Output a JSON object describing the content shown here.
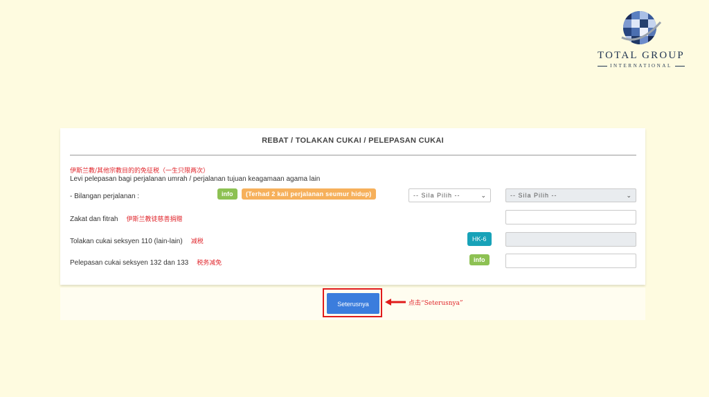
{
  "brand": {
    "name": "TOTAL GROUP",
    "tagline": "INTERNATIONAL"
  },
  "form": {
    "title": "REBAT / TOLAKAN CUKAI / PELEPASAN CUKAI",
    "levi_note_cn": "伊斯兰教/其他宗教目的的免征税（一生只限两次）",
    "levi_text": "Levi pelepasan bagi perjalanan umrah / perjalanan tujuan keagamaan agama lain",
    "rows": {
      "bilangan": {
        "label": "- Bilangan perjalanan :",
        "info_badge": "info",
        "limit_badge": "(Terhad 2 kali perjalanan seumur hidup)",
        "select1_value": "-- Sila Pilih --",
        "select2_value": "-- Sila Pilih --"
      },
      "zakat": {
        "label": "Zakat dan fitrah",
        "note_cn": "伊斯兰教徒慈善捐赠",
        "value": ""
      },
      "tolakan": {
        "label": "Tolakan cukai seksyen 110 (lain-lain)",
        "note_cn": "减税",
        "badge": "HK-6",
        "value": ""
      },
      "pelepasan": {
        "label": "Pelepasan cukai seksyen 132 dan 133",
        "note_cn": "税务减免",
        "badge": "info",
        "value": ""
      }
    }
  },
  "actions": {
    "next_label": "Seterusnya",
    "click_note_cn": "点击“Seterusnya”"
  },
  "colors": {
    "background": "#fefbe0",
    "accent_blue": "#3b7ddd",
    "info_green": "#8dc153",
    "warn_orange": "#f6b05b",
    "teal": "#17a2b8",
    "annotation_red": "#e01b1b"
  }
}
